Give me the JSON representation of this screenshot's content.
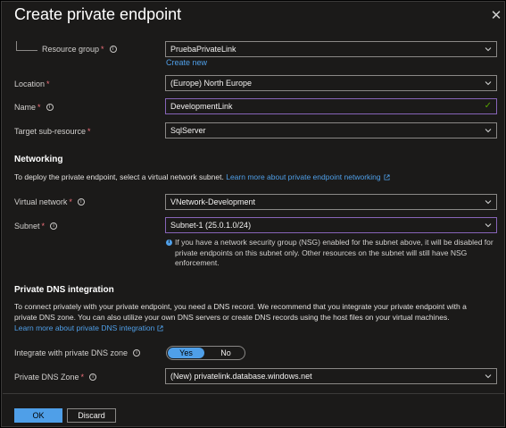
{
  "dialog": {
    "title": "Create private endpoint",
    "close_glyph": "✕"
  },
  "form": {
    "resource_group": {
      "label": "Resource group",
      "required": "*",
      "info": "i",
      "value": "PruebaPrivateLink",
      "create_new": "Create new"
    },
    "location": {
      "label": "Location",
      "required": "*",
      "value": "(Europe) North Europe"
    },
    "name": {
      "label": "Name",
      "required": "*",
      "info": "i",
      "value": "DevelopmentLink",
      "valid_glyph": "✓"
    },
    "target_sub_resource": {
      "label": "Target sub-resource",
      "required": "*",
      "value": "SqlServer"
    }
  },
  "networking": {
    "heading": "Networking",
    "description": "To deploy the private endpoint, select a virtual network subnet.",
    "learn_more": "Learn more about private endpoint networking",
    "virtual_network": {
      "label": "Virtual network",
      "required": "*",
      "info": "i",
      "value": "VNetwork-Development"
    },
    "subnet": {
      "label": "Subnet",
      "required": "*",
      "info": "i",
      "value": "Subnet-1 (25.0.1.0/24)"
    },
    "nsg_note": "If you have a network security group (NSG) enabled for the subnet above, it will be disabled for private endpoints on this subnet only. Other resources on the subnet will still have NSG enforcement.",
    "nsg_note_icon": "i"
  },
  "dns": {
    "heading": "Private DNS integration",
    "description_1": "To connect privately with your private endpoint, you need a DNS record. We recommend that you integrate your private endpoint with a",
    "description_2": "private DNS zone. You can also utilize your own DNS servers or create DNS records using the host files on your virtual machines.",
    "learn_more": "Learn more about private DNS integration",
    "integrate": {
      "label": "Integrate with private DNS zone",
      "info": "i",
      "yes": "Yes",
      "no": "No",
      "selected": "Yes"
    },
    "zone": {
      "label": "Private DNS Zone",
      "required": "*",
      "info": "i",
      "value": "(New) privatelink.database.windows.net"
    }
  },
  "footer": {
    "ok_label": "OK",
    "discard_label": "Discard"
  },
  "colors": {
    "accent": "#4f9fe8",
    "required": "#f1707b",
    "valid": "#57a300",
    "background": "#1b1a19"
  }
}
